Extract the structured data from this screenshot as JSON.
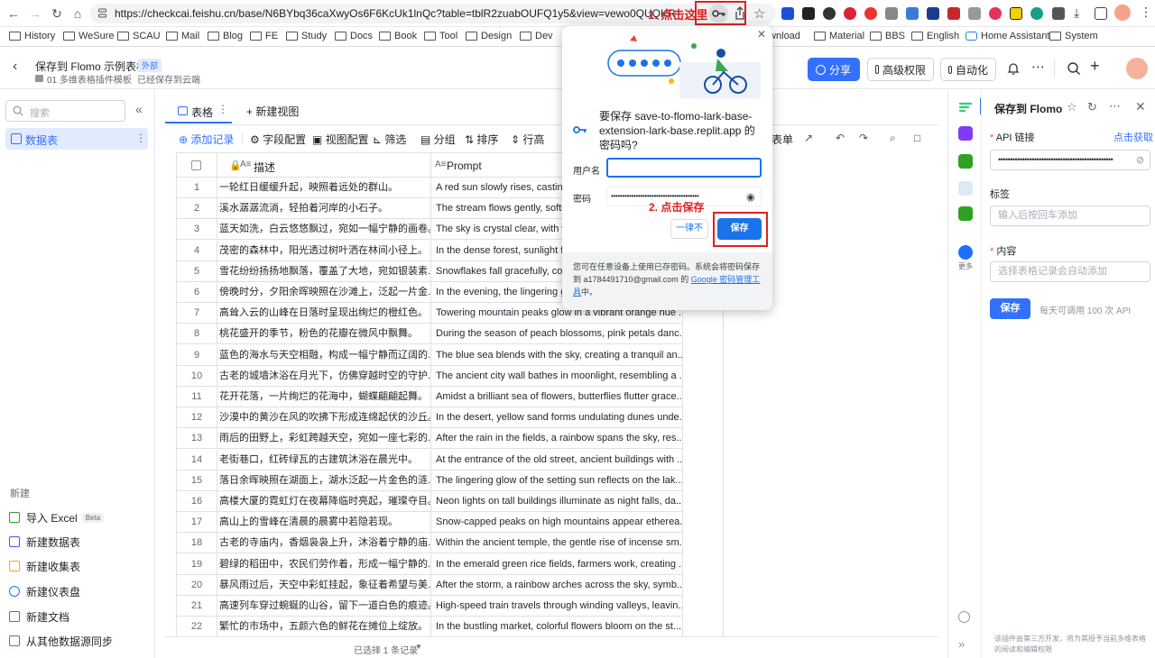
{
  "browser": {
    "url": "https://checkcai.feishu.cn/base/N6BYbq36caXwyOs6F6KcUk1lnQc?table=tblR2zuabOUFQ1y5&view=vewo0QUQKR",
    "annotation_step1": "1. 点击这里",
    "annotation_step2": "2. 点击保存",
    "bookmarks": [
      "History",
      "WeSure",
      "SCAU",
      "Mail",
      "Blog",
      "FE",
      "Study",
      "Docs",
      "Book",
      "Tool",
      "Design",
      "Dev",
      "Download",
      "Material",
      "BBS",
      "English",
      "Home Assistant",
      "System"
    ]
  },
  "header": {
    "title": "保存到 Flomo 示例表格",
    "external_badge": "外部",
    "breadcrumb": "01 多维表格插件模板",
    "save_status": "已经保存到云端",
    "share_label": "分享",
    "permission_label": "高级权限",
    "automation_label": "自动化"
  },
  "sidebar": {
    "search_placeholder": "搜索",
    "active_item": "数据表",
    "new_section": "新建",
    "new_items": [
      {
        "label": "导入 Excel",
        "badge": "Beta",
        "color": "#2ea121"
      },
      {
        "label": "新建数据表",
        "color": "#7f3bf5"
      },
      {
        "label": "新建收集表",
        "color": "#f5a623"
      },
      {
        "label": "新建仪表盘",
        "color": "#1e6fff"
      },
      {
        "label": "新建文档",
        "color": "#3370ff"
      },
      {
        "label": "从其他数据源同步",
        "color": "#2ea121"
      }
    ]
  },
  "main": {
    "tabs": {
      "table": "表格",
      "new_view": "新建视图"
    },
    "toolbar": {
      "add_record": "添加记录",
      "field_config": "字段配置",
      "view_config": "视图配置",
      "filter": "筛选",
      "group": "分组",
      "sort": "排序",
      "row_height": "行高",
      "form": "表单"
    },
    "columns": [
      "描述",
      "Prompt"
    ],
    "rows": [
      {
        "n": "1",
        "desc": "一轮红日缓缓升起，映照着远处的群山。",
        "prompt": "A red sun slowly rises, casting"
      },
      {
        "n": "2",
        "desc": "溪水潺潺流淌，轻拍着河岸的小石子。",
        "prompt": "The stream flows gently, softly"
      },
      {
        "n": "3",
        "desc": "蓝天如洗，白云悠悠飘过，宛如一幅宁静的画卷。",
        "prompt": "The sky is crystal clear, with w"
      },
      {
        "n": "4",
        "desc": "茂密的森林中，阳光透过树叶洒在林间小径上。",
        "prompt": "In the dense forest, sunlight fil"
      },
      {
        "n": "5",
        "desc": "雪花纷纷扬扬地飘落，覆盖了大地，宛如银装素...",
        "prompt": "Snowflakes fall gracefully, cov"
      },
      {
        "n": "6",
        "desc": "傍晚时分，夕阳余晖映照在沙滩上，泛起一片金...",
        "prompt": "In the evening, the lingering gl"
      },
      {
        "n": "7",
        "desc": "高耸入云的山峰在日落时呈现出绚烂的橙红色。",
        "prompt": "Towering mountain peaks glow in a vibrant orange hue ..."
      },
      {
        "n": "8",
        "desc": "桃花盛开的季节，粉色的花瓣在微风中飘舞。",
        "prompt": "During the season of peach blossoms, pink petals danc..."
      },
      {
        "n": "9",
        "desc": "蓝色的海水与天空相融，构成一幅宁静而辽阔的...",
        "prompt": "The blue sea blends with the sky, creating a tranquil an..."
      },
      {
        "n": "10",
        "desc": "古老的城墙沐浴在月光下，仿佛穿越时空的守护...",
        "prompt": "The ancient city wall bathes in moonlight, resembling a ..."
      },
      {
        "n": "11",
        "desc": "花开花落，一片绚烂的花海中，蝴蝶翩翩起舞。",
        "prompt": "Amidst a brilliant sea of flowers, butterflies flutter grace..."
      },
      {
        "n": "12",
        "desc": "沙漠中的黄沙在风的吹拂下形成连绵起伏的沙丘。",
        "prompt": "In the desert, yellow sand forms undulating dunes unde..."
      },
      {
        "n": "13",
        "desc": "雨后的田野上，彩虹跨越天空，宛如一座七彩的...",
        "prompt": "After the rain in the fields, a rainbow spans the sky, res..."
      },
      {
        "n": "14",
        "desc": "老街巷口，红砖绿瓦的古建筑沐浴在晨光中。",
        "prompt": "At the entrance of the old street, ancient buildings with ..."
      },
      {
        "n": "15",
        "desc": "落日余晖映照在湖面上，湖水泛起一片金色的涟...",
        "prompt": "The lingering glow of the setting sun reflects on the lak..."
      },
      {
        "n": "16",
        "desc": "高楼大厦的霓虹灯在夜幕降临时亮起，璀璨夺目。",
        "prompt": "Neon lights on tall buildings illuminate as night falls, da..."
      },
      {
        "n": "17",
        "desc": "高山上的雪峰在清晨的晨雾中若隐若现。",
        "prompt": "Snow-capped peaks on high mountains appear etherea..."
      },
      {
        "n": "18",
        "desc": "古老的寺庙内，香烟袅袅上升，沐浴着宁静的庙...",
        "prompt": "Within the ancient temple, the gentle rise of incense sm..."
      },
      {
        "n": "19",
        "desc": "碧绿的稻田中，农民们劳作着，形成一幅宁静的...",
        "prompt": "In the emerald green rice fields, farmers work, creating ..."
      },
      {
        "n": "20",
        "desc": "暴风雨过后，天空中彩虹挂起，象征着希望与美...",
        "prompt": "After the storm, a rainbow arches across the sky, symb..."
      },
      {
        "n": "21",
        "desc": "高速列车穿过蜿蜒的山谷，留下一道白色的痕迹。",
        "prompt": "High-speed train travels through winding valleys, leavin..."
      },
      {
        "n": "22",
        "desc": "繁忙的市场中，五颜六色的鲜花在摊位上绽放。",
        "prompt": "In the bustling market, colorful flowers bloom on the st..."
      }
    ],
    "status": "已选择 1 条记录"
  },
  "right_panel": {
    "title": "保存到 Flomo",
    "more_label": "更多",
    "api_label": "API 链接",
    "api_get": "点击获取",
    "api_value": "••••••••••••••••••••••••••••••••••••••••••••••••",
    "tags_label": "标签",
    "tags_placeholder": "输入后按回车添加",
    "content_label": "内容",
    "content_placeholder": "选择表格记录会自动添加",
    "save_button": "保存",
    "quota": "每天可调用 100 次 API",
    "footer": "该插件由第三方开发，将为其授予当前多维表格的阅读和编辑权限"
  },
  "password_popup": {
    "title": "要保存 save-to-flomo-lark-base-extension-lark-base.replit.app 的密码吗?",
    "username_label": "用户名",
    "username_value": "",
    "password_label": "密码",
    "password_value": "•••••••••••••••••••••••••••••••••••••••",
    "never_label": "一律不",
    "save_label": "保存",
    "footer_text": "您可在任意设备上使用已存密码。系统会将密码保存到 a1784491710@gmail.com 的",
    "footer_link": "Google 密码管理工具",
    "footer_tail": "中。",
    "accent": "#1a73e8"
  }
}
